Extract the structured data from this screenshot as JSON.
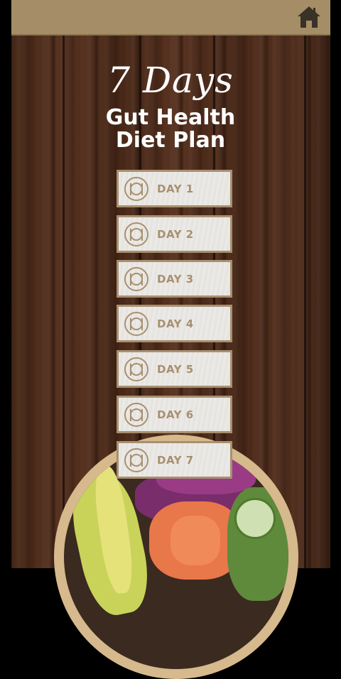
{
  "header": {
    "home_icon": "home-icon"
  },
  "title": {
    "script": "7 Days",
    "line1": "Gut Health",
    "line2": "Diet Plan"
  },
  "days": [
    {
      "label": "DAY 1",
      "icon": "plate-icon"
    },
    {
      "label": "DAY 2",
      "icon": "plate-icon"
    },
    {
      "label": "DAY 3",
      "icon": "plate-icon"
    },
    {
      "label": "DAY 4",
      "icon": "plate-icon"
    },
    {
      "label": "DAY 5",
      "icon": "plate-icon"
    },
    {
      "label": "DAY 6",
      "icon": "plate-icon"
    },
    {
      "label": "DAY 7",
      "icon": "plate-icon"
    }
  ],
  "colors": {
    "header_bar": "#a58d67",
    "button_border": "#a89070",
    "button_face": "#e8e6e2",
    "title_text": "#ffffff"
  }
}
